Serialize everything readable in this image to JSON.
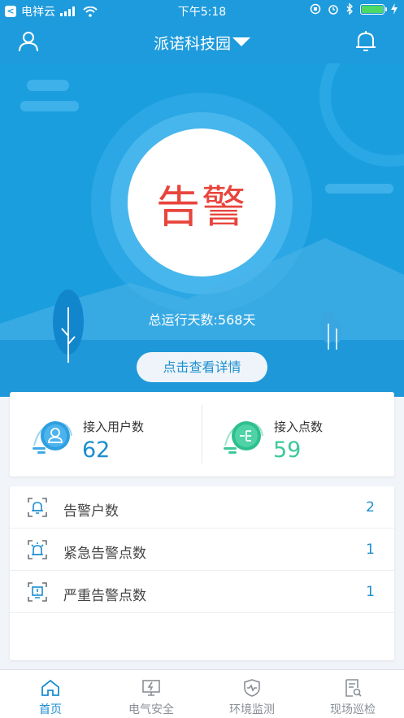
{
  "status_bar": {
    "carrier": "电祥云",
    "time": "下午5:18"
  },
  "nav": {
    "title": "派诺科技园"
  },
  "hero": {
    "status": "告警",
    "run_days": "总运行天数:568天",
    "detail_button": "点击查看详情"
  },
  "stats": [
    {
      "label": "接入用户数",
      "value": "62",
      "color": "#1b8ed0",
      "icon": "users-icon"
    },
    {
      "label": "接入点数",
      "value": "59",
      "color": "#3ec89c",
      "icon": "access-point-icon"
    }
  ],
  "alarms": [
    {
      "label": "告警户数",
      "value": "2",
      "icon": "alarm-bell-icon"
    },
    {
      "label": "紧急告警点数",
      "value": "1",
      "icon": "siren-icon"
    },
    {
      "label": "严重告警点数",
      "value": "1",
      "icon": "warning-screen-icon"
    }
  ],
  "tabs": [
    {
      "label": "首页",
      "icon": "home-icon",
      "active": true
    },
    {
      "label": "电气安全",
      "icon": "electrical-safety-icon",
      "active": false
    },
    {
      "label": "环境监测",
      "icon": "shield-monitor-icon",
      "active": false
    },
    {
      "label": "现场巡检",
      "icon": "inspection-icon",
      "active": false
    }
  ],
  "colors": {
    "primary": "#1e9bdc",
    "alarm_red": "#e8453c",
    "green": "#3ec89c"
  }
}
